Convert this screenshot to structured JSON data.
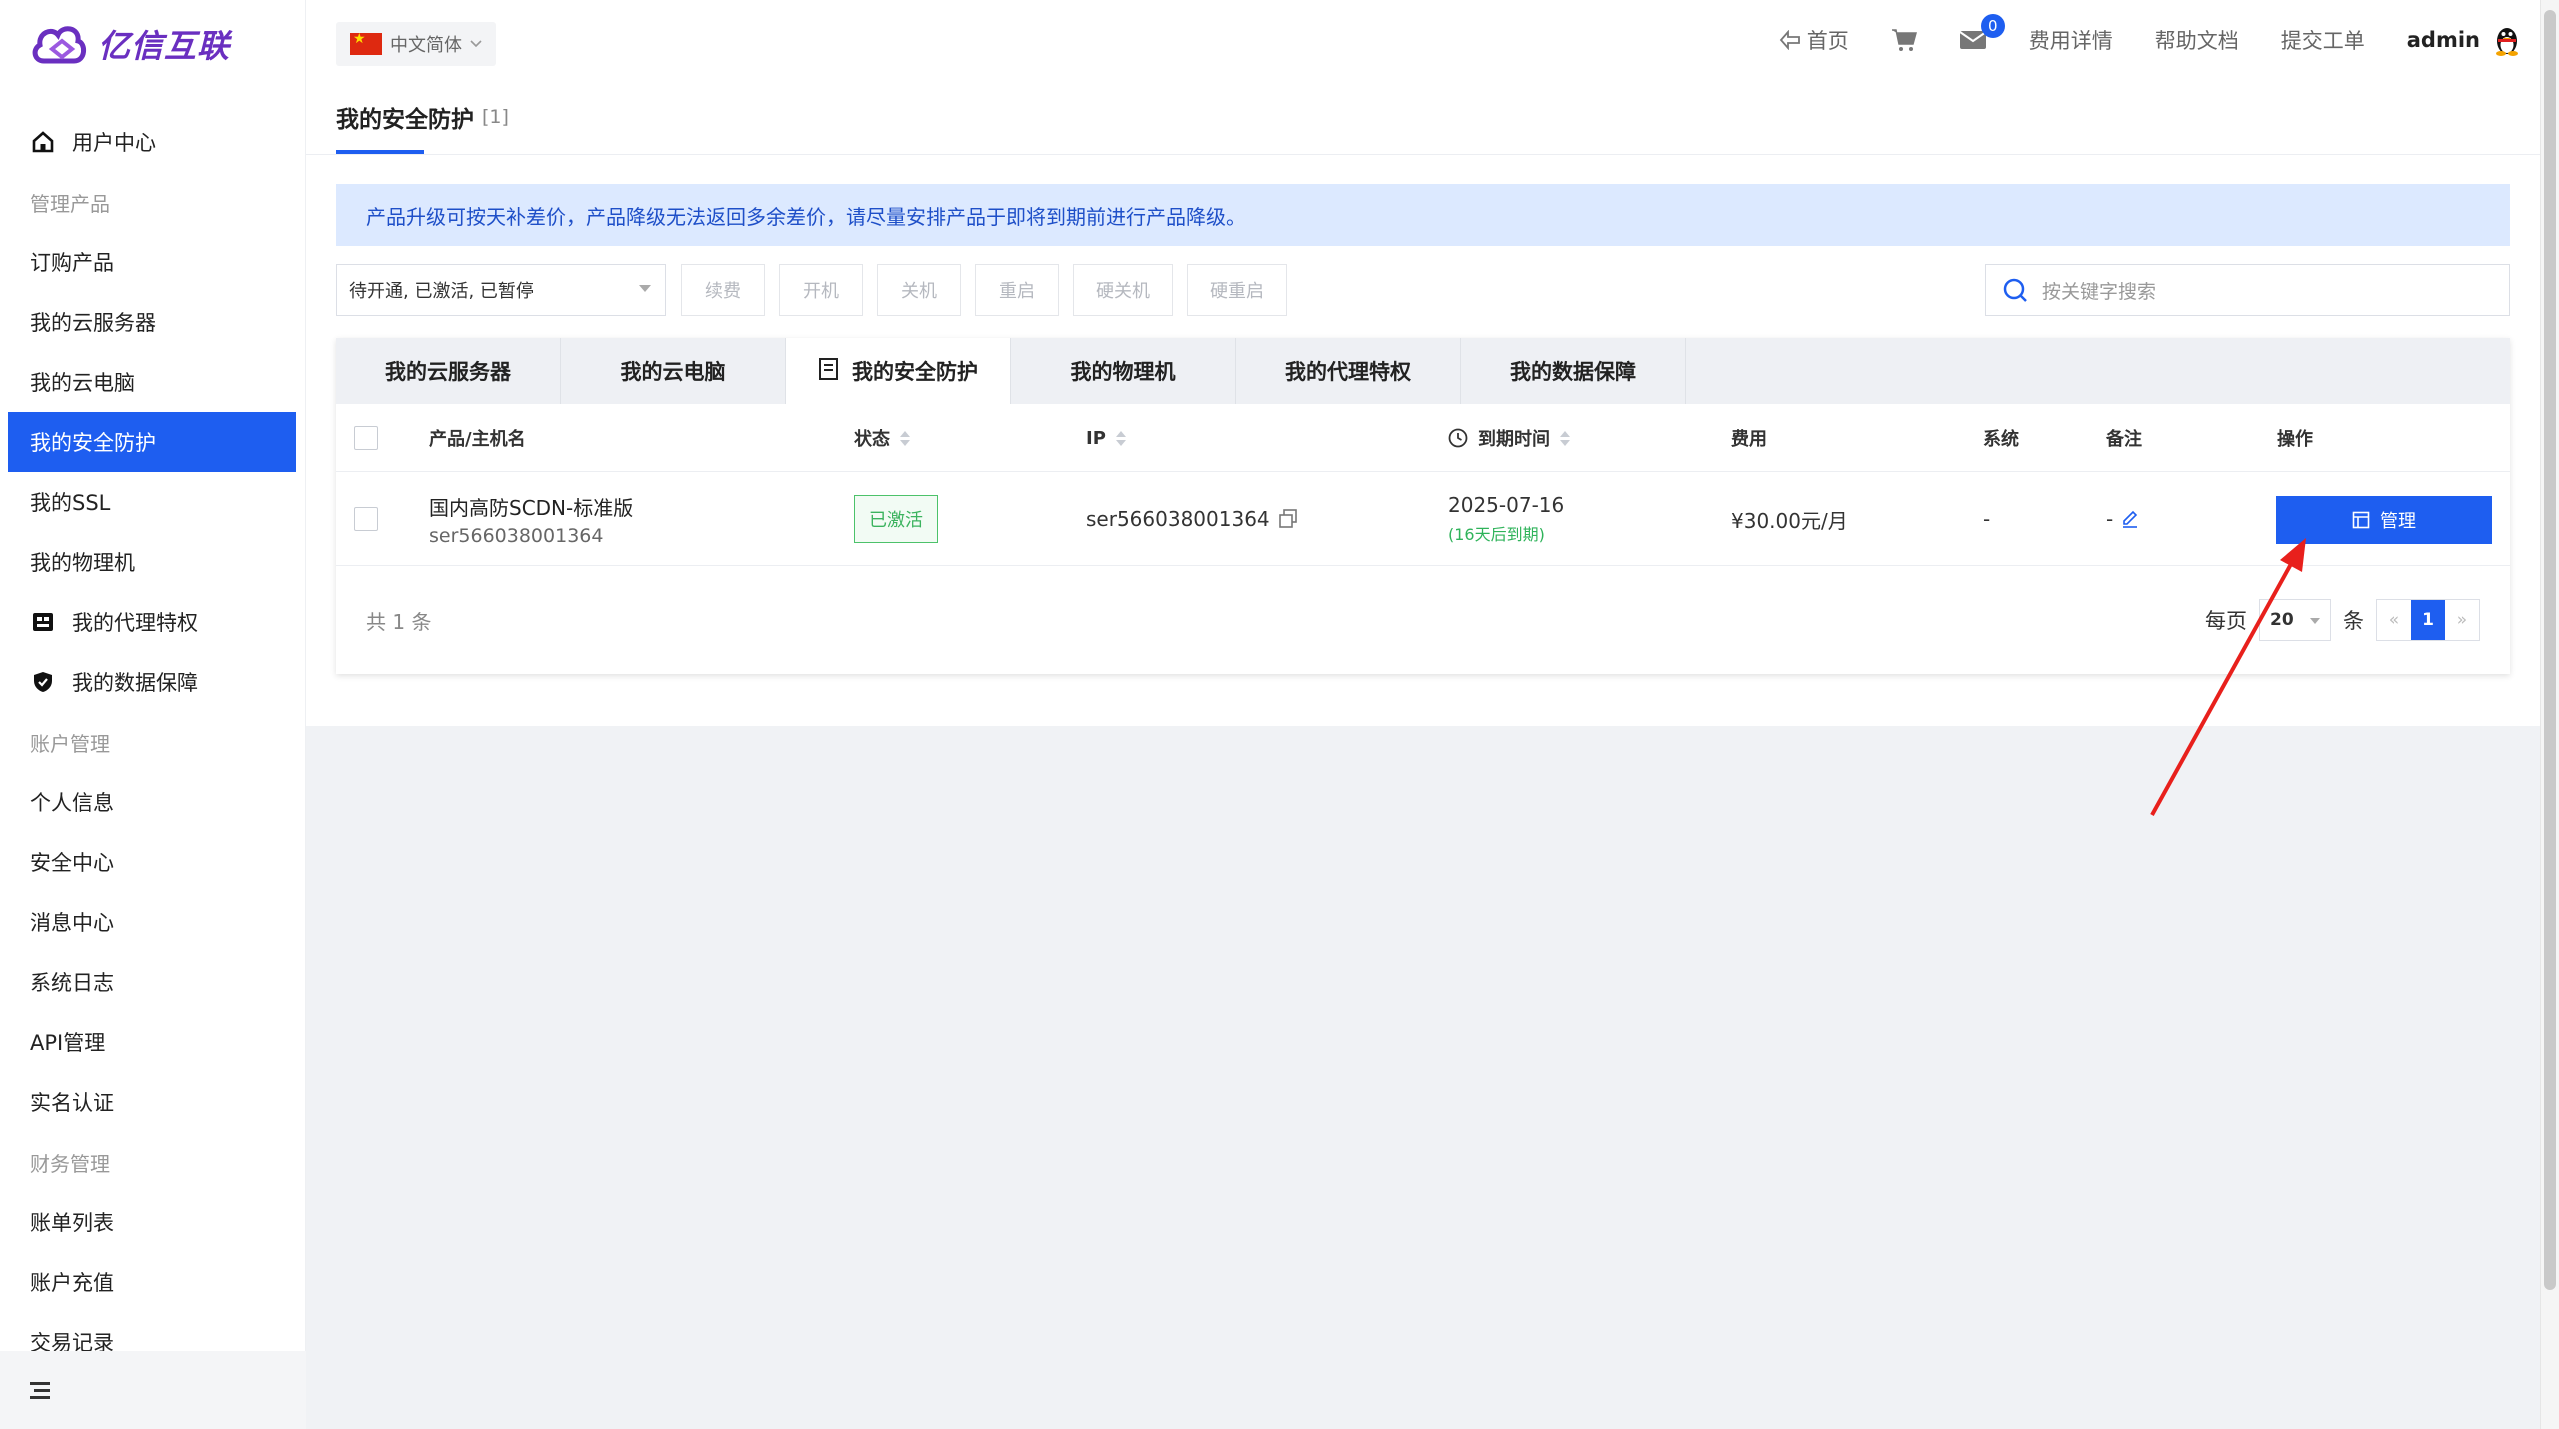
{
  "brand": {
    "name": "亿信互联",
    "accent": "#6a2fc0",
    "primary": "#1e5ef0"
  },
  "language": {
    "label": "中文简体"
  },
  "header": {
    "home": "首页",
    "cart_icon": "cart-icon",
    "mail_icon": "mail-icon",
    "mail_count": "0",
    "billing": "费用详情",
    "docs": "帮助文档",
    "ticket": "提交工单",
    "user": "admin"
  },
  "sidebar": {
    "items": [
      {
        "type": "item",
        "label": "用户中心",
        "icon": "home-icon"
      },
      {
        "type": "group",
        "label": "管理产品"
      },
      {
        "type": "item",
        "label": "订购产品"
      },
      {
        "type": "item",
        "label": "我的云服务器"
      },
      {
        "type": "item",
        "label": "我的云电脑"
      },
      {
        "type": "item",
        "label": "我的安全防护",
        "active": true
      },
      {
        "type": "item",
        "label": "我的SSL"
      },
      {
        "type": "item",
        "label": "我的物理机"
      },
      {
        "type": "item",
        "label": "我的代理特权",
        "icon": "store-icon"
      },
      {
        "type": "item",
        "label": "我的数据保障",
        "icon": "shield-icon"
      },
      {
        "type": "group",
        "label": "账户管理"
      },
      {
        "type": "item",
        "label": "个人信息"
      },
      {
        "type": "item",
        "label": "安全中心"
      },
      {
        "type": "item",
        "label": "消息中心"
      },
      {
        "type": "item",
        "label": "系统日志"
      },
      {
        "type": "item",
        "label": "API管理"
      },
      {
        "type": "item",
        "label": "实名认证"
      },
      {
        "type": "group",
        "label": "财务管理"
      },
      {
        "type": "item",
        "label": "账单列表"
      },
      {
        "type": "item",
        "label": "账户充值"
      },
      {
        "type": "item",
        "label": "交易记录"
      }
    ]
  },
  "page": {
    "title": "我的安全防护",
    "count": "[1]",
    "notice": "产品升级可按天补差价，产品降级无法返回多余差价，请尽量安排产品于即将到期前进行产品降级。"
  },
  "toolbar": {
    "status_filter": "待开通, 已激活, 已暂停",
    "buttons": [
      "续费",
      "开机",
      "关机",
      "重启",
      "硬关机",
      "硬重启"
    ],
    "search_placeholder": "按关键字搜索"
  },
  "tabs": [
    {
      "label": "我的云服务器"
    },
    {
      "label": "我的云电脑"
    },
    {
      "label": "我的安全防护",
      "active": true
    },
    {
      "label": "我的物理机"
    },
    {
      "label": "我的代理特权"
    },
    {
      "label": "我的数据保障"
    }
  ],
  "table": {
    "headers": {
      "product": "产品/主机名",
      "status": "状态",
      "ip": "IP",
      "expire": "到期时间",
      "fee": "费用",
      "system": "系统",
      "note": "备注",
      "action": "操作"
    },
    "rows": [
      {
        "product": "国内高防SCDN-标准版",
        "host": "ser566038001364",
        "status": "已激活",
        "ip": "ser566038001364",
        "expire_date": "2025-07-16",
        "expire_note": "(16天后到期)",
        "fee": "¥30.00元/月",
        "system": "-",
        "note": "-",
        "action": "管理"
      }
    ]
  },
  "pagination": {
    "total": "共 1 条",
    "per_page_label": "每页",
    "per_page": "20",
    "unit": "条",
    "prev": "«",
    "current": "1",
    "next": "»"
  },
  "sidebar_collapse_icon": "menu-collapse-icon"
}
